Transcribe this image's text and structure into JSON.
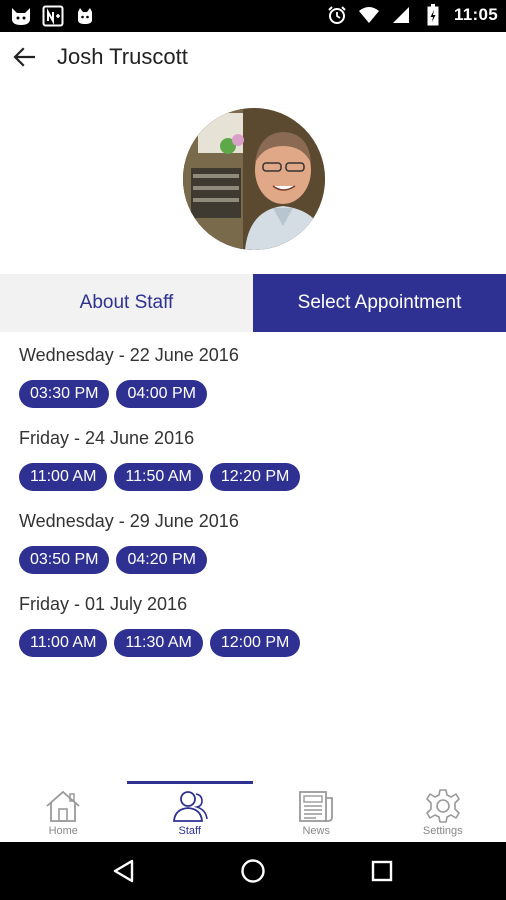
{
  "status_bar": {
    "time": "11:05",
    "left_icons": [
      "cat-icon",
      "news-app-icon",
      "android-icon"
    ],
    "right_icons": [
      "alarm-icon",
      "wifi-icon",
      "signal-icon",
      "battery-icon"
    ]
  },
  "app_bar": {
    "title": "Josh Truscott"
  },
  "tabs": [
    {
      "label": "About Staff",
      "active": false
    },
    {
      "label": "Select Appointment",
      "active": true
    }
  ],
  "appointments": [
    {
      "date": "Wednesday - 22 June 2016",
      "slots": [
        "03:30 PM",
        "04:00 PM"
      ]
    },
    {
      "date": "Friday - 24 June 2016",
      "slots": [
        "11:00 AM",
        "11:50 AM",
        "12:20 PM"
      ]
    },
    {
      "date": "Wednesday - 29 June 2016",
      "slots": [
        "03:50 PM",
        "04:20 PM"
      ]
    },
    {
      "date": "Friday - 01 July 2016",
      "slots": [
        "11:00 AM",
        "11:30 AM",
        "12:00 PM"
      ]
    }
  ],
  "bottom_nav": [
    {
      "label": "Home",
      "icon": "home-icon",
      "active": false
    },
    {
      "label": "Staff",
      "icon": "staff-icon",
      "active": true
    },
    {
      "label": "News",
      "icon": "news-icon",
      "active": false
    },
    {
      "label": "Settings",
      "icon": "settings-icon",
      "active": false
    }
  ],
  "colors": {
    "accent": "#2e3192",
    "tab_inactive_bg": "#f2f2f2",
    "text": "#333333",
    "nav_inactive": "#888888"
  }
}
